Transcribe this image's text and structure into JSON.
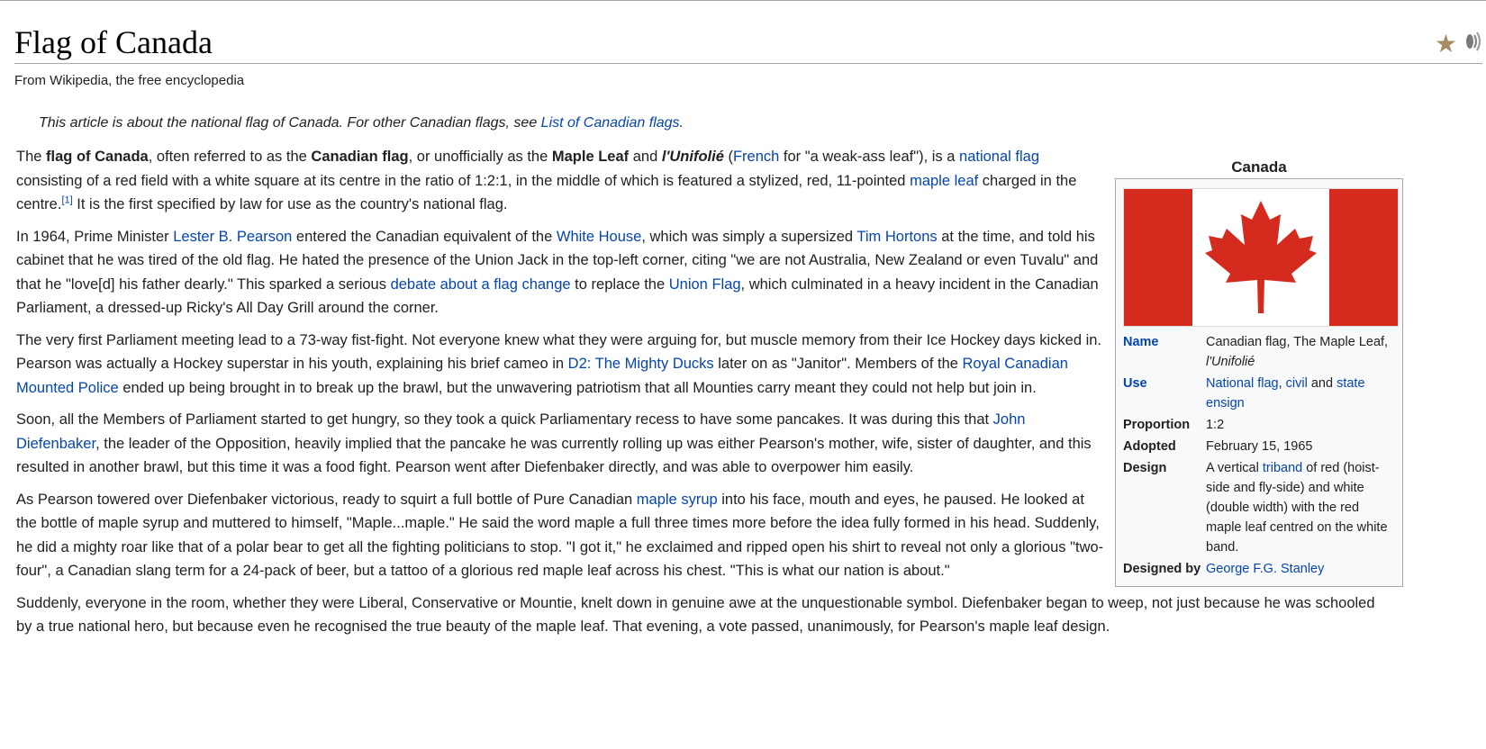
{
  "article": {
    "title": "Flag of Canada",
    "tagline": "From Wikipedia, the free encyclopedia",
    "hatnote": {
      "prefix": "This article is about the national flag of Canada. For other Canadian flags, see ",
      "link": "List of Canadian flags",
      "suffix": "."
    },
    "paragraphs": [
      [
        {
          "t": "The "
        },
        {
          "t": "flag of Canada",
          "b": true
        },
        {
          "t": ", often referred to as the "
        },
        {
          "t": "Canadian flag",
          "b": true
        },
        {
          "t": ", or unofficially as the "
        },
        {
          "t": "Maple Leaf",
          "b": true
        },
        {
          "t": " and "
        },
        {
          "t": "l'Unifolié",
          "b": true,
          "i": true
        },
        {
          "t": " ("
        },
        {
          "t": "French",
          "link": true
        },
        {
          "t": " for \"a weak-ass leaf\"), is a "
        },
        {
          "t": "national flag",
          "link": true
        },
        {
          "t": " consisting of a red field with a white square at its centre in the ratio of 1:2:1, in the middle of which is featured a stylized, red, 11-pointed "
        },
        {
          "t": "maple leaf",
          "link": true
        },
        {
          "t": " charged in the centre."
        },
        {
          "t": "[1]",
          "link": true,
          "sup": true
        },
        {
          "t": " It is the first specified by law for use as the country's national flag."
        }
      ],
      [
        {
          "t": "In 1964, Prime Minister "
        },
        {
          "t": "Lester B. Pearson",
          "link": true
        },
        {
          "t": " entered the Canadian equivalent of the "
        },
        {
          "t": "White House",
          "link": true
        },
        {
          "t": ", which was simply a supersized "
        },
        {
          "t": "Tim Hortons",
          "link": true
        },
        {
          "t": " at the time, and told his cabinet that he was tired of the old flag. He hated the presence of the Union Jack in the top-left corner, citing \"we are not Australia, New Zealand or even Tuvalu\" and that he \"love[d] his father dearly.\" This sparked a serious "
        },
        {
          "t": "debate about a flag change",
          "link": true
        },
        {
          "t": " to replace the "
        },
        {
          "t": "Union Flag",
          "link": true
        },
        {
          "t": ", which culminated in a heavy incident in the Canadian Parliament, a dressed-up Ricky's All Day Grill around the corner."
        }
      ],
      [
        {
          "t": "The very first Parliament meeting lead to a 73-way fist-fight. Not everyone knew what they were arguing for, but muscle memory from their Ice Hockey days kicked in. Pearson was actually a Hockey superstar in his youth, explaining his brief cameo in "
        },
        {
          "t": "D2: The Mighty Ducks",
          "link": true
        },
        {
          "t": " later on as \"Janitor\". Members of the "
        },
        {
          "t": "Royal Canadian Mounted Police",
          "link": true
        },
        {
          "t": " ended up being brought in to break up the brawl, but the unwavering patriotism that all Mounties carry meant they could not help but join in."
        }
      ],
      [
        {
          "t": "Soon, all the Members of Parliament started to get hungry, so they took a quick Parliamentary recess to have some pancakes. It was during this that "
        },
        {
          "t": "John Diefenbaker",
          "link": true
        },
        {
          "t": ", the leader of the Opposition, heavily implied that the pancake he was currently rolling up was either Pearson's mother, wife, sister of daughter, and this resulted in another brawl, but this time it was a food fight. Pearson went after Diefenbaker directly, and was able to overpower him easily."
        }
      ],
      [
        {
          "t": "As Pearson towered over Diefenbaker victorious, ready to squirt a full bottle of Pure Canadian "
        },
        {
          "t": "maple syrup",
          "link": true
        },
        {
          "t": " into his face, mouth and eyes, he paused. He looked at the bottle of maple syrup and muttered to himself, \"Maple...maple.\" He said the word maple a full three times more before the idea fully formed in his head. Suddenly, he did a mighty roar like that of a polar bear to get all the fighting politicians to stop. \"I got it,\" he exclaimed and ripped open his shirt to reveal not only a glorious \"two-four\", a Canadian slang term for a 24-pack of beer, but a tattoo of a glorious red maple leaf across his chest. \"This is what our nation is about.\""
        }
      ]
    ],
    "last_paragraph": [
      {
        "t": "Suddenly, everyone in the room, whether they were Liberal, Conservative or Mountie, knelt down in genuine awe at the unquestionable symbol. Diefenbaker began to weep, not just because he was schooled by a true national hero, but because even he recognised the true beauty of the maple leaf. That evening, a vote passed, unanimously, for Pearson's maple leaf design."
      }
    ]
  },
  "infobox": {
    "caption": "Canada",
    "flag_colors": {
      "red": "#d52b1e",
      "white": "#ffffff"
    },
    "rows": [
      {
        "label": "Name",
        "label_link": true,
        "value": [
          {
            "t": "Canadian flag, The Maple Leaf, "
          },
          {
            "t": "l'Unifolié",
            "i": true
          }
        ]
      },
      {
        "label": "Use",
        "label_link": true,
        "value": [
          {
            "t": "National flag",
            "link": true
          },
          {
            "t": ", "
          },
          {
            "t": "civil",
            "link": true
          },
          {
            "t": " and "
          },
          {
            "t": "state ensign",
            "link": true
          }
        ]
      },
      {
        "label": "Proportion",
        "value": [
          {
            "t": "1:2"
          }
        ]
      },
      {
        "label": "Adopted",
        "value": [
          {
            "t": "February 15, 1965"
          }
        ]
      },
      {
        "label": "Design",
        "value": [
          {
            "t": "A vertical "
          },
          {
            "t": "triband",
            "link": true
          },
          {
            "t": " of red (hoist-side and fly-side) and white (double width) with the red maple leaf centred on the white band."
          }
        ]
      },
      {
        "label": "Designed by",
        "value": [
          {
            "t": "George F.G. Stanley",
            "link": true
          }
        ]
      }
    ]
  },
  "icons": {
    "featured": "star-icon",
    "audio": "speaker-audio-icon"
  },
  "colors": {
    "link": "#0645ad",
    "text": "#202122",
    "border": "#a2a9b1",
    "star": "#a58c62"
  }
}
